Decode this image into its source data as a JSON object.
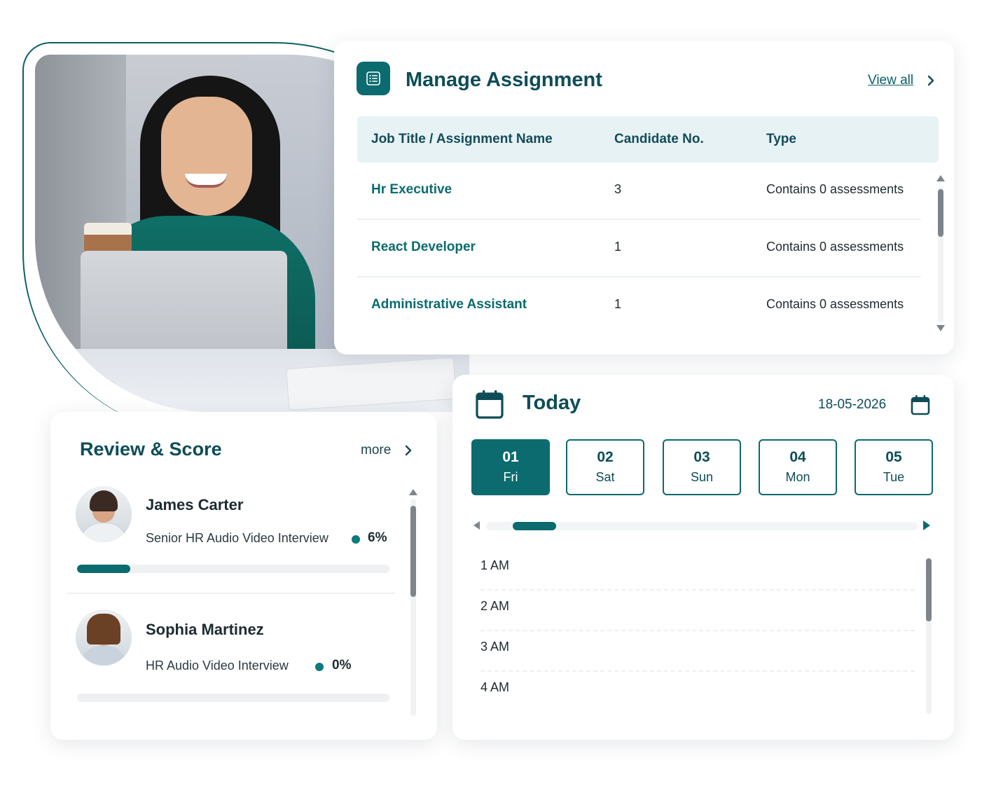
{
  "assignment": {
    "title": "Manage Assignment",
    "view_all": "View all",
    "columns": [
      "Job Title / Assignment Name",
      "Candidate No.",
      "Type"
    ],
    "rows": [
      {
        "name": "Hr Executive",
        "candidates": "3",
        "type": "Contains 0 assessments"
      },
      {
        "name": "React Developer",
        "candidates": "1",
        "type": "Contains 0 assessments"
      },
      {
        "name": "Administrative Assistant",
        "candidates": "1",
        "type": "Contains 0 assessments"
      }
    ]
  },
  "review": {
    "title": "Review & Score",
    "more": "more",
    "candidates": [
      {
        "name": "James Carter",
        "role": "Senior HR Audio Video Interview",
        "percent": "6%",
        "progress": 0.17
      },
      {
        "name": "Sophia Martinez",
        "role": "HR Audio Video Interview",
        "percent": "0%",
        "progress": 0
      }
    ]
  },
  "today": {
    "title": "Today",
    "date": "18-05-2026",
    "days": [
      {
        "num": "01",
        "name": "Fri",
        "active": true
      },
      {
        "num": "02",
        "name": "Sat",
        "active": false
      },
      {
        "num": "03",
        "name": "Sun",
        "active": false
      },
      {
        "num": "04",
        "name": "Mon",
        "active": false
      },
      {
        "num": "05",
        "name": "Tue",
        "active": false
      }
    ],
    "hours": [
      "1 AM",
      "2 AM",
      "3 AM",
      "4 AM"
    ]
  },
  "colors": {
    "accent": "#0b6b6e",
    "heading": "#0d4d57",
    "table_header_bg": "#e7f2f5"
  },
  "icons": {
    "assignment": "list-icon",
    "calendar": "calendar-icon",
    "chevron": "chevron-right-icon"
  }
}
